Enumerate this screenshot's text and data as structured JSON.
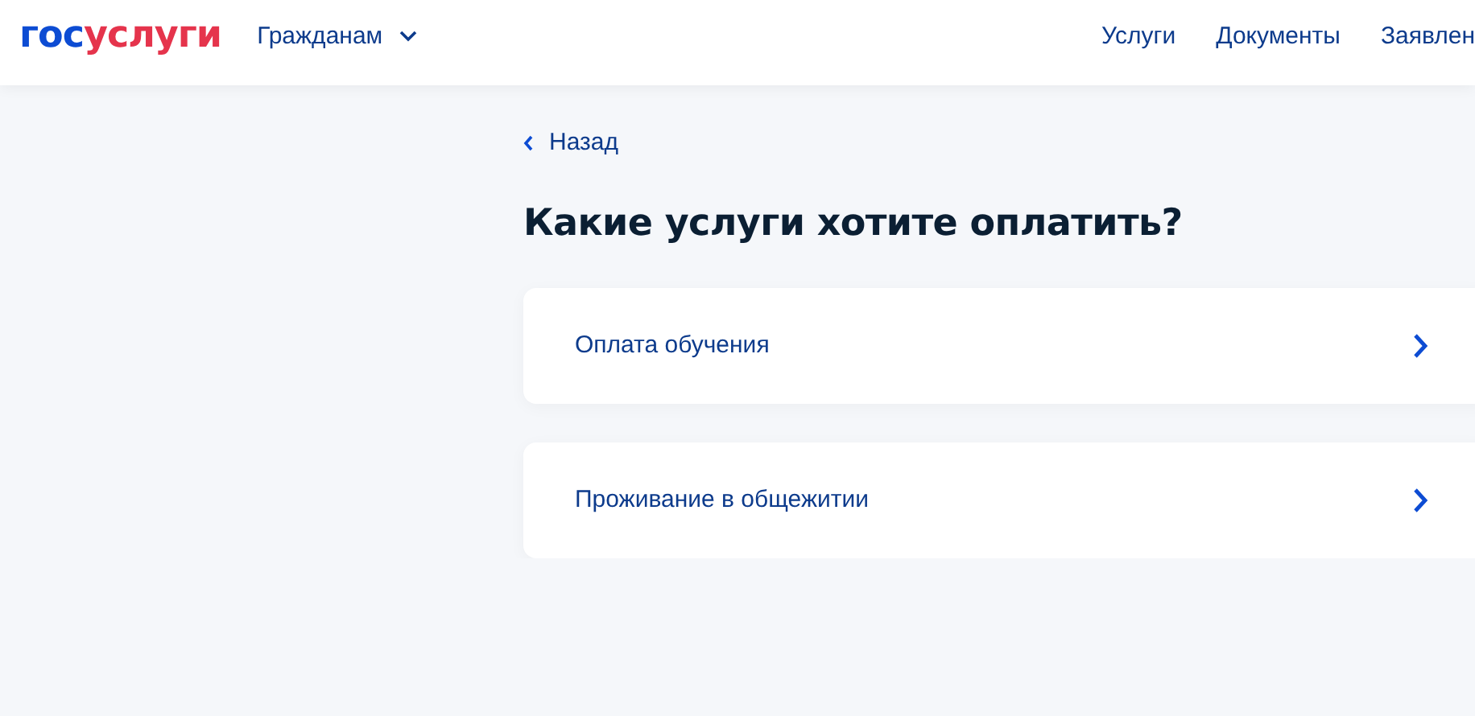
{
  "header": {
    "logo": {
      "prefix": "гос",
      "suffix": "услуги"
    },
    "audience": {
      "label": "Гражданам",
      "expanded": false
    },
    "nav": [
      {
        "label": "Услуги"
      },
      {
        "label": "Документы"
      },
      {
        "label": "Заявлен"
      }
    ]
  },
  "back": {
    "label": "Назад"
  },
  "title": "Какие услуги хотите оплатить?",
  "options": [
    {
      "label": "Оплата обучения"
    },
    {
      "label": "Проживание в общежитии"
    }
  ]
}
